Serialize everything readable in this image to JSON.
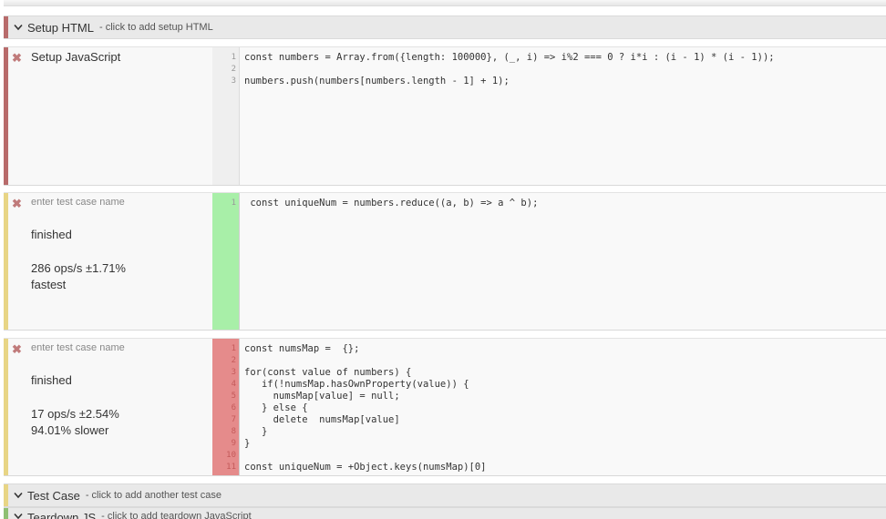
{
  "colors": {
    "setup_bar": "#b86b6b",
    "green_bar": "#e8d585",
    "fast_gutter": "#a8efa8",
    "slow_gutter": "#e58b8b",
    "test_bar": "#8fbf73"
  },
  "setup_html": {
    "title": "Setup HTML",
    "hint": "- click to add setup HTML"
  },
  "setup_js": {
    "title": "Setup JavaScript",
    "remove_icon": "✖",
    "line_numbers": [
      "1",
      "2",
      "3"
    ],
    "lines": [
      "const numbers = Array.from({length: 100000}, (_, i) => i%2 === 0 ? i*i : (i - 1) * (i - 1));",
      "",
      "numbers.push(numbers[numbers.length - 1] + 1);"
    ]
  },
  "test_cases": [
    {
      "remove_icon": "✖",
      "name_placeholder": "enter test case name",
      "status": "finished",
      "ops": "286 ops/s ±1.71%",
      "comparison": "fastest",
      "line_numbers": [
        "1"
      ],
      "lines": [
        " const uniqueNum = numbers.reduce((a, b) => a ^ b);"
      ]
    },
    {
      "remove_icon": "✖",
      "name_placeholder": "enter test case name",
      "status": "finished",
      "ops": "17 ops/s ±2.54%",
      "comparison": "94.01% slower",
      "line_numbers": [
        "1",
        "2",
        "3",
        "4",
        "5",
        "6",
        "7",
        "8",
        "9",
        "10",
        "11"
      ],
      "lines": [
        "const numsMap =  {};",
        "",
        "for(const value of numbers) {",
        "   if(!numsMap.hasOwnProperty(value)) {",
        "     numsMap[value] = null;",
        "   } else {",
        "     delete  numsMap[value]",
        "   }",
        "}",
        "",
        "const uniqueNum = +Object.keys(numsMap)[0]"
      ]
    }
  ],
  "test_case_header": {
    "title": "Test Case",
    "hint": "- click to add another test case"
  },
  "teardown_header": {
    "title": "Teardown JS",
    "hint": "- click to add teardown JavaScript"
  }
}
